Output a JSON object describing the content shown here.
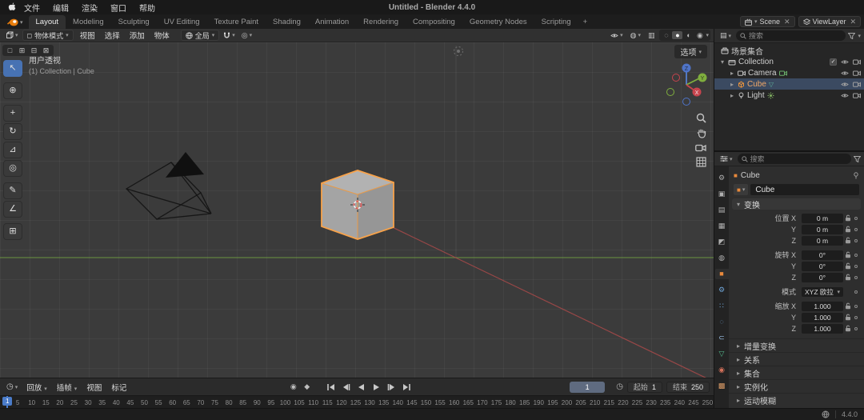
{
  "macos": {
    "title": "Untitled - Blender 4.4.0",
    "menus": [
      "文件",
      "编辑",
      "渲染",
      "窗口",
      "帮助"
    ]
  },
  "topbar": {
    "tabs": [
      {
        "label": "Layout",
        "cls": "active"
      },
      {
        "label": "Modeling",
        "cls": ""
      },
      {
        "label": "Sculpting",
        "cls": ""
      },
      {
        "label": "UV Editing",
        "cls": ""
      },
      {
        "label": "Texture Paint",
        "cls": ""
      },
      {
        "label": "Shading",
        "cls": ""
      },
      {
        "label": "Animation",
        "cls": ""
      },
      {
        "label": "Rendering",
        "cls": ""
      },
      {
        "label": "Compositing",
        "cls": ""
      },
      {
        "label": "Geometry Nodes",
        "cls": ""
      },
      {
        "label": "Scripting",
        "cls": ""
      },
      {
        "label": "+",
        "cls": "plus"
      }
    ],
    "scene": "Scene",
    "viewlayer": "ViewLayer"
  },
  "viewport": {
    "header": {
      "mode": "物体模式",
      "menus": [
        "视图",
        "选择",
        "添加",
        "物体"
      ],
      "orientation": "全局"
    },
    "tool_settings": {
      "select_modes": [
        "□",
        "⊞",
        "⊟",
        "⊠"
      ],
      "options": "选项"
    },
    "overlay": {
      "view_label": "用户透视",
      "breadcrumb": "(1) Collection | Cube"
    },
    "gizmo": {
      "x": "X",
      "y": "Y",
      "z": "Z"
    }
  },
  "toolbar": {
    "tools": [
      {
        "name": "tool-tweak-select",
        "glyph": "↖",
        "cls": "active"
      },
      {
        "name": "tool-cursor",
        "glyph": "⊕",
        "cls": "gap"
      },
      {
        "name": "tool-move",
        "glyph": "+",
        "cls": "gap"
      },
      {
        "name": "tool-rotate",
        "glyph": "↻",
        "cls": ""
      },
      {
        "name": "tool-scale",
        "glyph": "⊿",
        "cls": ""
      },
      {
        "name": "tool-transform",
        "glyph": "◎",
        "cls": ""
      },
      {
        "name": "tool-annotate",
        "glyph": "✎",
        "cls": "gap"
      },
      {
        "name": "tool-measure",
        "glyph": "∠",
        "cls": ""
      },
      {
        "name": "tool-add-cube",
        "glyph": "⊞",
        "cls": "gap"
      }
    ]
  },
  "outliner": {
    "search": "搜索",
    "scene_collection": "场景集合",
    "collection": "Collection",
    "camera": "Camera",
    "cube": "Cube",
    "light": "Light"
  },
  "properties": {
    "search": "搜索",
    "tabs": [
      {
        "name": "tab-tool",
        "glyph": "⚙",
        "color": "#b0b0b0",
        "cls": ""
      },
      {
        "name": "tab-render",
        "glyph": "▣",
        "color": "#b0b0b0",
        "cls": ""
      },
      {
        "name": "tab-output",
        "glyph": "▤",
        "color": "#b0b0b0",
        "cls": ""
      },
      {
        "name": "tab-view-layer",
        "glyph": "▦",
        "color": "#b0b0b0",
        "cls": ""
      },
      {
        "name": "tab-scene",
        "glyph": "◩",
        "color": "#b0b0b0",
        "cls": ""
      },
      {
        "name": "tab-world",
        "glyph": "◍",
        "color": "#b0b0b0",
        "cls": ""
      },
      {
        "name": "tab-object",
        "glyph": "■",
        "color": "#e8893c",
        "cls": "active"
      },
      {
        "name": "tab-modifiers",
        "glyph": "⚙",
        "color": "#71a8dc",
        "cls": ""
      },
      {
        "name": "tab-particles",
        "glyph": "∷",
        "color": "#71a8dc",
        "cls": ""
      },
      {
        "name": "tab-physics",
        "glyph": "◌",
        "color": "#71a8dc",
        "cls": ""
      },
      {
        "name": "tab-constraints",
        "glyph": "⊂",
        "color": "#9ec3e8",
        "cls": ""
      },
      {
        "name": "tab-object-data",
        "glyph": "▽",
        "color": "#54b88c",
        "cls": ""
      },
      {
        "name": "tab-material",
        "glyph": "◉",
        "color": "#d3705a",
        "cls": ""
      },
      {
        "name": "tab-texture",
        "glyph": "▩",
        "color": "#d99a66",
        "cls": ""
      }
    ],
    "breadcrumb": "Cube",
    "name": "Cube",
    "transform_title": "变换",
    "rows": [
      {
        "label": "位置 X",
        "value": "0 m",
        "cls": ""
      },
      {
        "label": "Y",
        "value": "0 m",
        "cls": ""
      },
      {
        "label": "Z",
        "value": "0 m",
        "cls": ""
      },
      {
        "label": "旋转 X",
        "value": "0°",
        "cls": "gap"
      },
      {
        "label": "Y",
        "value": "0°",
        "cls": ""
      },
      {
        "label": "Z",
        "value": "0°",
        "cls": ""
      },
      {
        "label": "模式",
        "value": "XYZ 欧拉",
        "cls": "gap nolock dropdown"
      },
      {
        "label": "缩放 X",
        "value": "1.000",
        "cls": "gap"
      },
      {
        "label": "Y",
        "value": "1.000",
        "cls": ""
      },
      {
        "label": "Z",
        "value": "1.000",
        "cls": ""
      }
    ],
    "collapsed": [
      "增量变换",
      "关系",
      "集合",
      "实例化",
      "运动模糊"
    ]
  },
  "timeline": {
    "menus": [
      {
        "label": "回放",
        "cls": "dd"
      },
      {
        "label": "插帧",
        "cls": "dd"
      },
      {
        "label": "视图",
        "cls": ""
      },
      {
        "label": "标记",
        "cls": ""
      }
    ],
    "current_frame": "1",
    "start_label": "起始",
    "start": "1",
    "end_label": "结束",
    "end": "250",
    "ruler_frames": [
      5,
      10,
      15,
      20,
      25,
      30,
      35,
      40,
      45,
      50,
      55,
      60,
      65,
      70,
      75,
      80,
      85,
      90,
      95,
      100,
      105,
      110,
      115,
      120,
      125,
      130,
      135,
      140,
      145,
      150,
      155,
      160,
      165,
      170,
      175,
      180,
      185,
      190,
      195,
      200,
      205,
      210,
      215,
      220,
      225,
      230,
      235,
      240,
      245,
      250
    ]
  },
  "statusbar": {
    "version": "4.4.0"
  }
}
